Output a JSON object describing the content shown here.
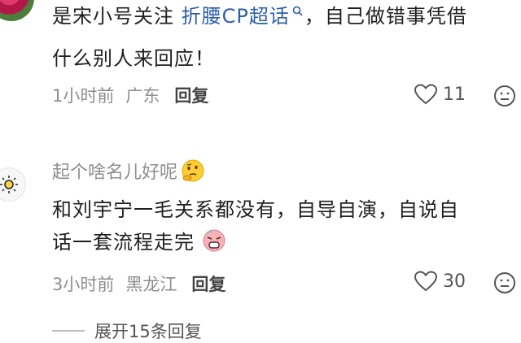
{
  "comments": [
    {
      "text_before": "是宋小号关注 ",
      "topic": "折腰CP超话",
      "text_line1_rest": "，自己做错事凭借",
      "text_line2": "什么别人来回应！",
      "time": "1小时前",
      "location": "广东",
      "reply_label": "回复",
      "likes": "11"
    },
    {
      "username": "起个啥名儿好呢",
      "text_line1": "和刘宇宁一毛关系都没有，自导自演，自说自",
      "text_line2": "话一套流程走完",
      "time": "3小时前",
      "location": "黑龙江",
      "reply_label": "回复",
      "likes": "30"
    }
  ],
  "expand_replies": "展开15条回复",
  "icons": [
    "heart-icon",
    "dislike-face-icon",
    "sun-icon",
    "thinking-emoji-icon",
    "search-icon",
    "tired-emoji-icon"
  ]
}
